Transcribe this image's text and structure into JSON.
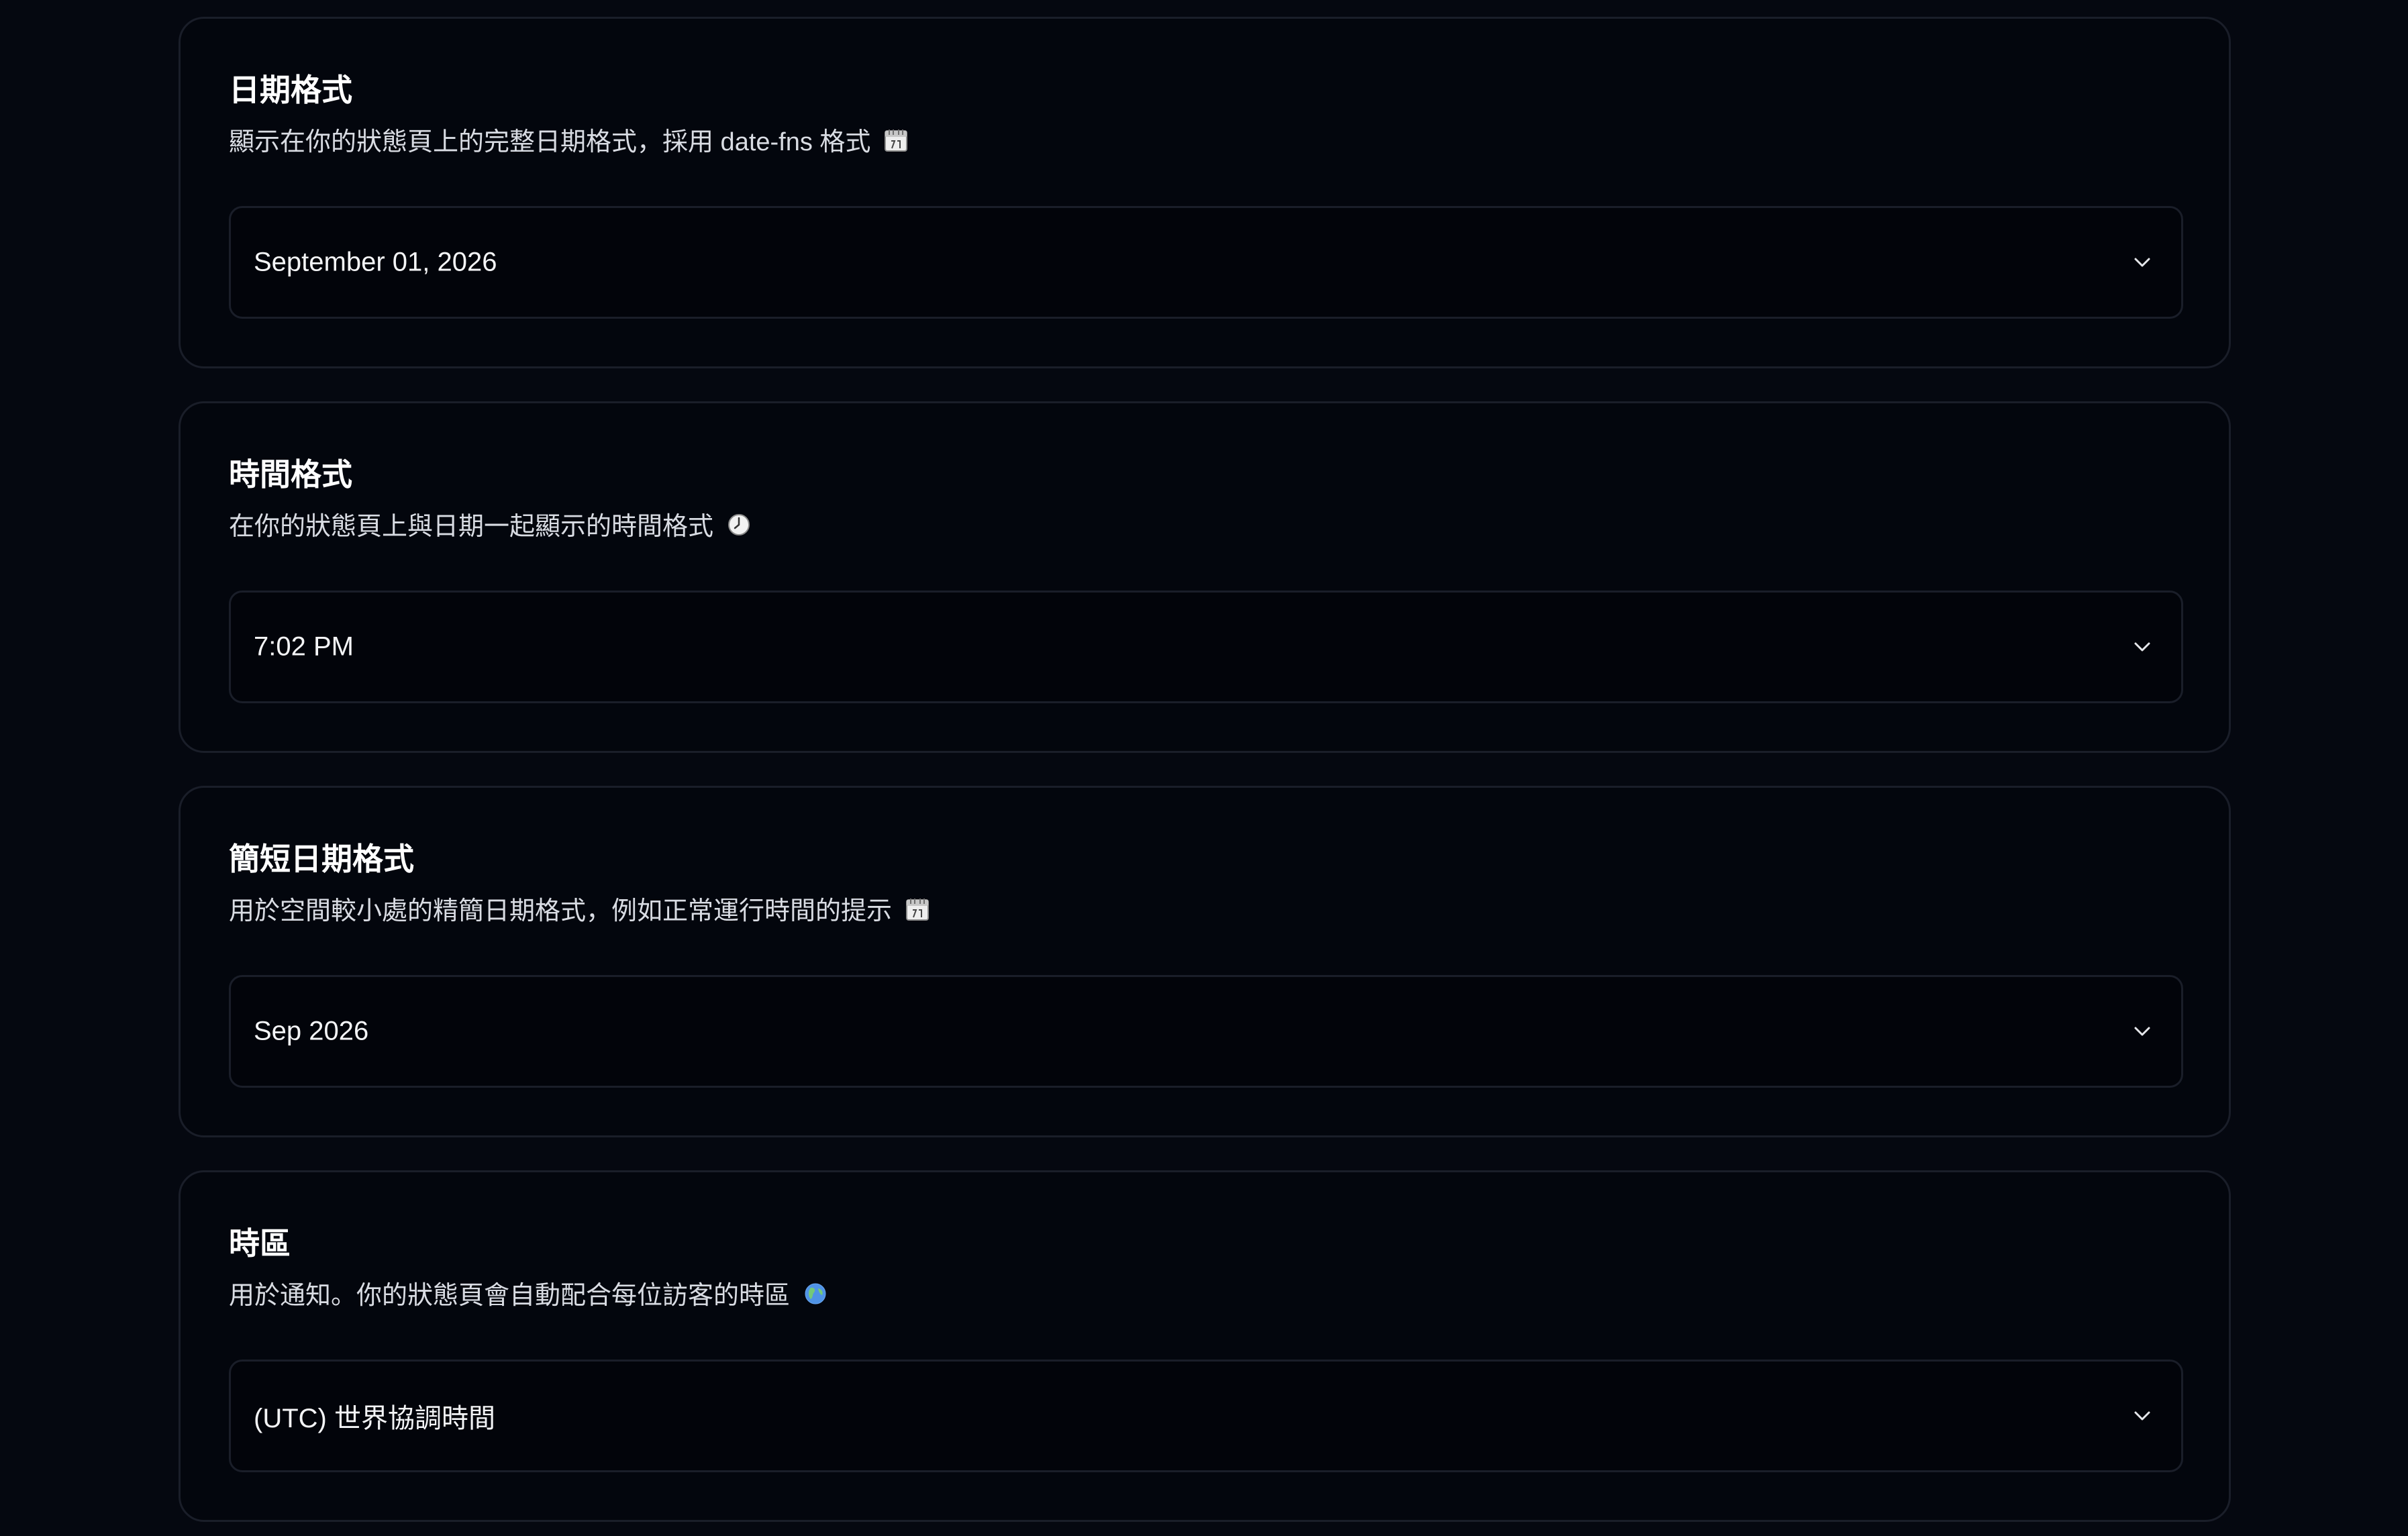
{
  "settings": [
    {
      "title": "日期格式",
      "description": "顯示在你的狀態頁上的完整日期格式，採用 date-fns 格式",
      "icon": "calendar-icon",
      "value": "September 01, 2026"
    },
    {
      "title": "時間格式",
      "description": "在你的狀態頁上與日期一起顯示的時間格式",
      "icon": "clock-icon",
      "value": "7:02 PM"
    },
    {
      "title": "簡短日期格式",
      "description": "用於空間較小處的精簡日期格式，例如正常運行時間的提示",
      "icon": "calendar-icon",
      "value": "Sep 2026"
    },
    {
      "title": "時區",
      "description": "用於通知。你的狀態頁會自動配合每位訪客的時區",
      "icon": "globe-icon",
      "value": "(UTC) 世界協調時間"
    }
  ],
  "chevron_icon": "chevron-down-icon"
}
